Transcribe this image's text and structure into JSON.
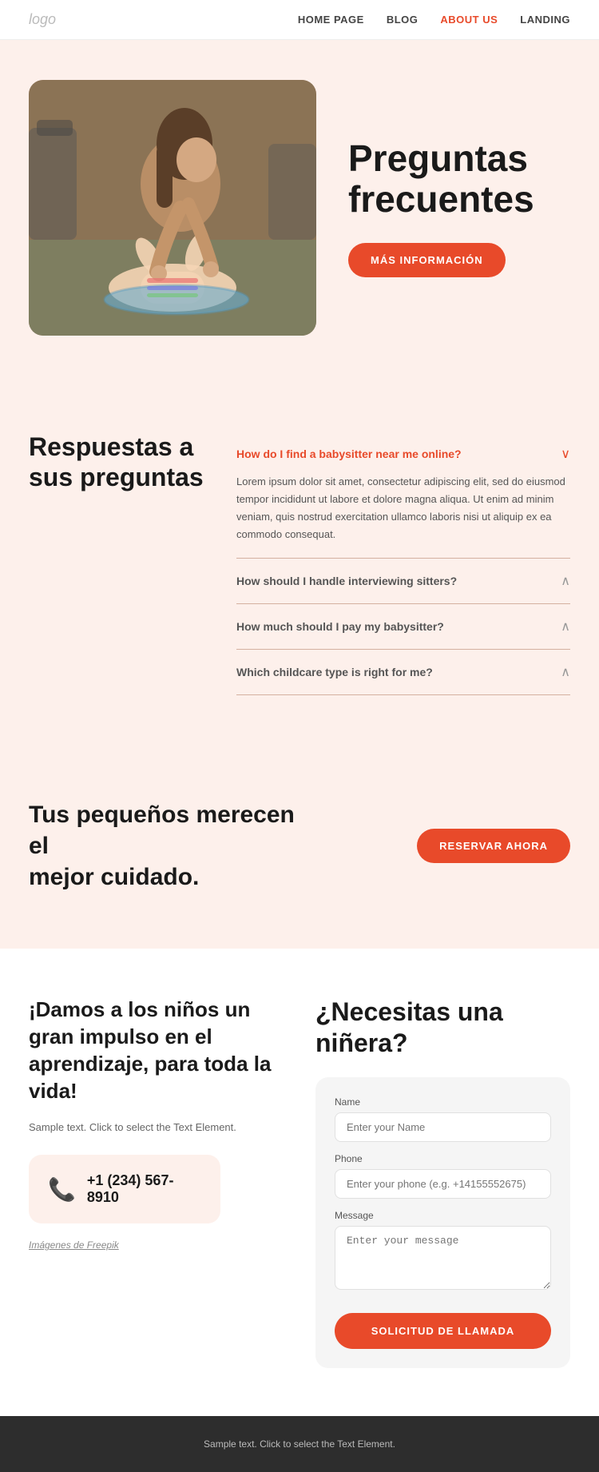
{
  "nav": {
    "logo": "logo",
    "links": [
      {
        "id": "home",
        "label": "HOME PAGE",
        "active": false
      },
      {
        "id": "blog",
        "label": "BLOG",
        "active": false
      },
      {
        "id": "about",
        "label": "ABOUT US",
        "active": true
      },
      {
        "id": "landing",
        "label": "LANDING",
        "active": false
      }
    ]
  },
  "hero": {
    "title_line1": "Preguntas",
    "title_line2": "frecuentes",
    "cta_button": "MÁS INFORMACIÓN"
  },
  "faq": {
    "section_title_line1": "Respuestas a",
    "section_title_line2": "sus preguntas",
    "items": [
      {
        "question": "How do I find a babysitter near me online?",
        "open": true,
        "answer": "Lorem ipsum dolor sit amet, consectetur adipiscing elit, sed do eiusmod tempor incididunt ut labore et dolore magna aliqua. Ut enim ad minim veniam, quis nostrud exercitation ullamco laboris nisi ut aliquip ex ea commodo consequat.",
        "highlight": true
      },
      {
        "question": "How should I handle interviewing sitters?",
        "open": false,
        "answer": "",
        "highlight": false
      },
      {
        "question": "How much should I pay my babysitter?",
        "open": false,
        "answer": "",
        "highlight": false
      },
      {
        "question": "Which childcare type is right for me?",
        "open": false,
        "answer": "",
        "highlight": false
      }
    ]
  },
  "cta": {
    "title_line1": "Tus pequeños merecen el",
    "title_line2": "mejor cuidado.",
    "button": "RESERVAR AHORA"
  },
  "contact_left": {
    "title": "¡Damos a los niños un gran impulso en el aprendizaje, para toda la vida!",
    "text": "Sample text. Click to select the Text Element.",
    "phone": "+1 (234) 567-8910",
    "freepik": "Imágenes de Freepik"
  },
  "form": {
    "title_line1": "¿Necesitas una",
    "title_line2": "niñera?",
    "fields": {
      "name_label": "Name",
      "name_placeholder": "Enter your Name",
      "phone_label": "Phone",
      "phone_placeholder": "Enter your phone (e.g. +14155552675)",
      "message_label": "Message",
      "message_placeholder": "Enter your message"
    },
    "submit_button": "SOLICITUD DE LLAMADA"
  },
  "footer": {
    "text": "Sample text. Click to select the Text Element."
  },
  "colors": {
    "orange": "#e84a2a",
    "bg_peach": "#fdf0eb",
    "dark": "#1a1a1a",
    "gray": "#555"
  }
}
